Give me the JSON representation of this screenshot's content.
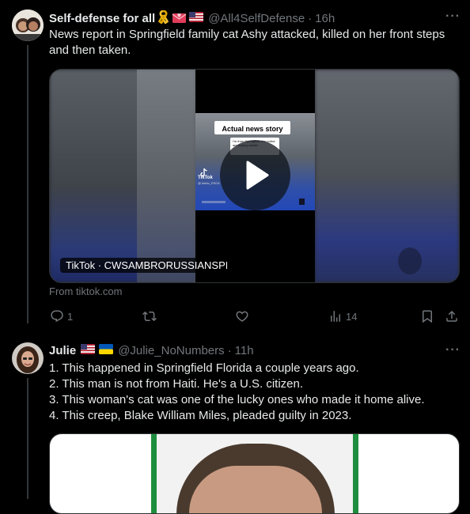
{
  "tweet1": {
    "display_name": "Self-defense for all",
    "handle": "@All4SelfDefense",
    "separator": "·",
    "time": "16h",
    "text": "News report in Springfield family cat Ashy attacked, killed on her front steps and then taken.",
    "video": {
      "headline": "Actual news story",
      "subline": "I'm from Springfield. the police are buying curtain.",
      "brand_text": "TikTok",
      "brand_handle": "@ kiddo_ESO4",
      "label": "TikTok · CWSAMBRORUSSIANSPI"
    },
    "source": "From tiktok.com",
    "replies": "1",
    "retweets": "",
    "likes": "",
    "views": "14"
  },
  "tweet2": {
    "display_name": "Julie",
    "handle": "@Julie_NoNumbers",
    "separator": "·",
    "time": "11h",
    "lines": [
      "1. This happened in Springfield Florida a couple years ago.",
      "2. This man is not from Haiti. He's a U.S. citizen.",
      "3. This woman's cat was one of the lucky ones who made it home alive.",
      "4. This creep, Blake William Miles, pleaded guilty in 2023."
    ]
  },
  "colors": {
    "background": "#000000",
    "text": "#e7e9ea",
    "muted": "#71767b",
    "border": "#2f3336",
    "mugshot_green": "#1e8e3e"
  }
}
